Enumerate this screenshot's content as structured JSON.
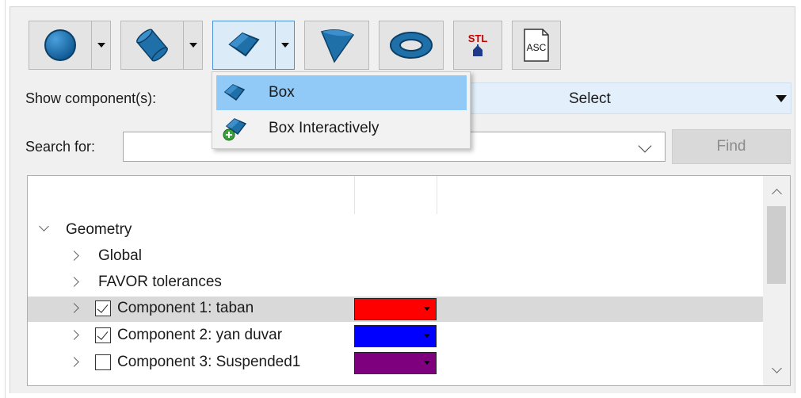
{
  "toolbar": {
    "buttons": [
      {
        "icon": "sphere-icon",
        "has_dropdown": true
      },
      {
        "icon": "cylinder-icon",
        "has_dropdown": true
      },
      {
        "icon": "box-icon",
        "has_dropdown": true,
        "active": true
      },
      {
        "icon": "cone-icon",
        "has_dropdown": false
      },
      {
        "icon": "torus-icon",
        "has_dropdown": false
      },
      {
        "icon": "stl-import-icon",
        "has_dropdown": false,
        "text": "STL"
      },
      {
        "icon": "asc-import-icon",
        "has_dropdown": false,
        "text": "ASC"
      }
    ]
  },
  "show_components": {
    "label": "Show component(s):",
    "value": "Select"
  },
  "search": {
    "label": "Search for:",
    "value": "",
    "find_label": "Find"
  },
  "tree": {
    "items": [
      {
        "label": "Geometry",
        "expanded": true,
        "level": 0
      },
      {
        "label": "Global",
        "level": 1
      },
      {
        "label": "FAVOR tolerances",
        "level": 1
      },
      {
        "label": "Component 1: taban",
        "level": 1,
        "checked": true,
        "color": "#ff0000",
        "selected": true
      },
      {
        "label": "Component 2: yan duvar",
        "level": 1,
        "checked": true,
        "color": "#0000ff"
      },
      {
        "label": "Component 3: Suspended1",
        "level": 1,
        "checked": false,
        "color": "#7f007f"
      }
    ]
  },
  "menu": {
    "items": [
      {
        "label": "Box",
        "highlighted": true
      },
      {
        "label": "Box Interactively"
      }
    ]
  },
  "colors": {
    "icon_blue": "#1f6fa8",
    "accent": "#4a90d9",
    "highlight": "#91c9f7"
  }
}
